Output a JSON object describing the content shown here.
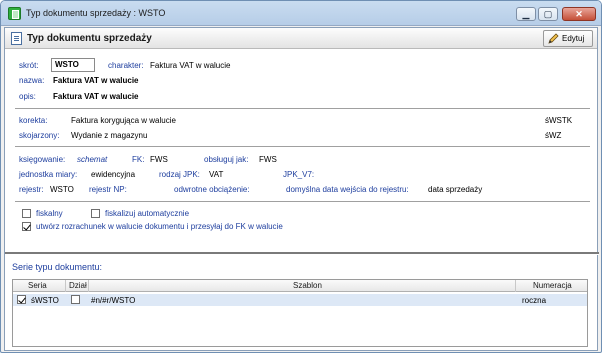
{
  "window": {
    "title": "Typ dokumentu sprzedaży : WSTO",
    "close_glyph": "✕",
    "min_glyph": "▁",
    "max_glyph": "▢"
  },
  "header": {
    "title": "Typ dokumentu sprzedaży",
    "edit_label": "Edytuj"
  },
  "fields": {
    "skrot_label": "skrót:",
    "skrot_value": "WSTO",
    "charakter_label": "charakter:",
    "charakter_value": "Faktura VAT w walucie",
    "nazwa_label": "nazwa:",
    "nazwa_value": "Faktura VAT w walucie",
    "opis_label": "opis:",
    "opis_value": "Faktura VAT w walucie"
  },
  "relations": {
    "korekta_label": "korekta:",
    "korekta_value": "Faktura korygująca w walucie",
    "korekta_code": "śWSTK",
    "skojarzony_label": "skojarzony:",
    "skojarzony_value": "Wydanie z magazynu",
    "skojarzony_code": "śWZ"
  },
  "accounting": {
    "ksiegowanie_label": "księgowanie:",
    "ksiegowanie_value": "schemat",
    "fk_label": "FK:",
    "fk_value": "FWS",
    "obsluguj_label": "obsługuj jak:",
    "obsluguj_value": "FWS",
    "jednostka_label": "jednostka miary:",
    "jednostka_value": "ewidencyjna",
    "rodzaj_label": "rodzaj JPK:",
    "rodzaj_value": "VAT",
    "jpk_label": "JPK_V7:",
    "jpk_value": "",
    "rejestr_label": "rejestr:",
    "rejestr_value": "WSTO",
    "rejestr_np_label": "rejestr NP:",
    "rejestr_np_value": "",
    "odwrotne_label": "odwrotne obciążenie:",
    "odwrotne_value": "",
    "domyslna_label": "domyślna data wejścia do rejestru:",
    "domyslna_value": "data sprzedaży"
  },
  "options": {
    "fiskalny_label": "fiskalny",
    "fiskalny_checked": false,
    "fiskalizuj_label": "fiskalizuj automatycznie",
    "fiskalizuj_checked": false,
    "rozrachunek_label": "utwórz rozrachunek w walucie dokumentu i przesyłaj do FK w walucie",
    "rozrachunek_checked": true
  },
  "series": {
    "section_label": "Serie typu dokumentu:",
    "columns": [
      "Seria",
      "Dział",
      "Szablon",
      "Numeracja"
    ],
    "rows": [
      {
        "checked": true,
        "seria": "śWSTO",
        "dzial_checked": false,
        "szablon": "#n/#r/WSTO",
        "numeracja": "roczna"
      }
    ]
  }
}
